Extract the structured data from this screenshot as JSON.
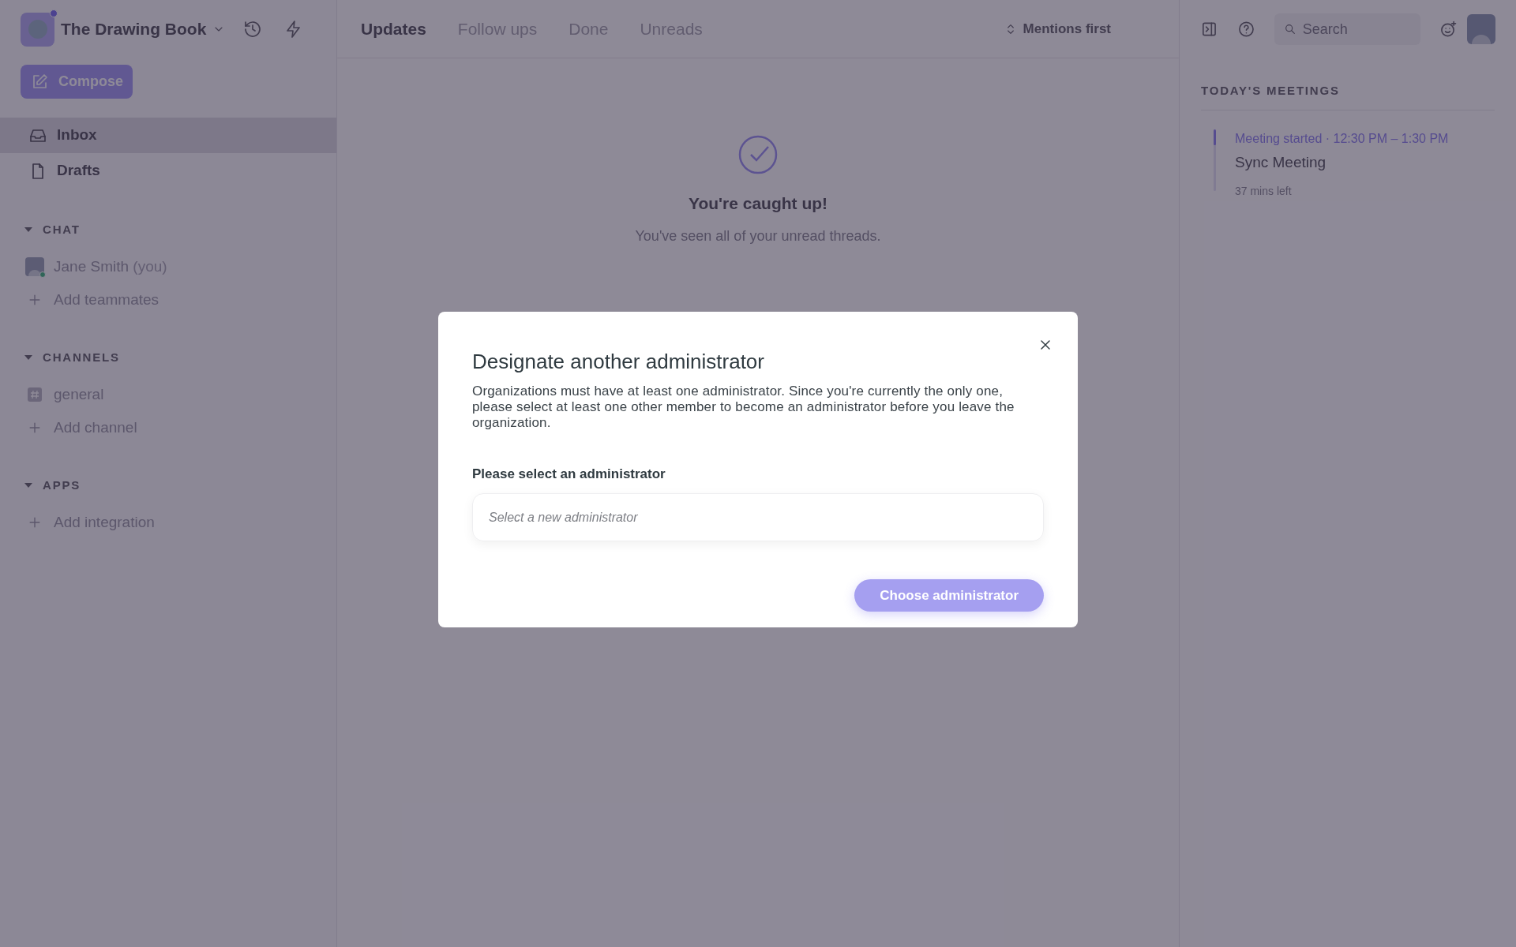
{
  "workspace": {
    "name": "The Drawing Book",
    "unread": true
  },
  "compose": "Compose",
  "nav": [
    {
      "label": "Inbox",
      "kind": "inbox",
      "selected": true
    },
    {
      "label": "Drafts",
      "kind": "drafts",
      "selected": false
    }
  ],
  "sections": [
    {
      "title": "CHAT",
      "expanded": true,
      "items": [
        {
          "kind": "person",
          "label": "Jane Smith",
          "suffix": "(you)",
          "online": true
        },
        {
          "kind": "add",
          "label": "Add teammates"
        }
      ]
    },
    {
      "title": "CHANNELS",
      "expanded": true,
      "items": [
        {
          "kind": "channel",
          "label": "general"
        },
        {
          "kind": "add",
          "label": "Add channel"
        }
      ]
    },
    {
      "title": "APPS",
      "expanded": true,
      "items": [
        {
          "kind": "add",
          "label": "Add integration"
        }
      ]
    }
  ],
  "tabs": [
    {
      "label": "Updates",
      "selected": true
    },
    {
      "label": "Follow ups",
      "selected": false
    },
    {
      "label": "Done",
      "selected": false
    },
    {
      "label": "Unreads",
      "selected": false
    }
  ],
  "sort": "Mentions first",
  "search": {
    "placeholder": "Search"
  },
  "empty_state": {
    "title": "You're caught up!",
    "text": "You've seen all of your unread threads."
  },
  "meetings": {
    "title": "TODAY'S MEETINGS",
    "items": [
      {
        "status": "Meeting started",
        "separator": "·",
        "time": "12:30 PM – 1:30 PM",
        "name": "Sync Meeting",
        "remaining": "37 mins left"
      }
    ]
  },
  "modal": {
    "title": "Designate another administrator",
    "text": "Organizations must have at least one administrator. Since you're currently the only one, please select at least one other member to become an administrator before you leave the organization.",
    "field_label": "Please select an administrator",
    "field": {
      "placeholder": "Select a new administrator"
    },
    "button": {
      "label": "Choose administrator",
      "disabled": true
    }
  }
}
